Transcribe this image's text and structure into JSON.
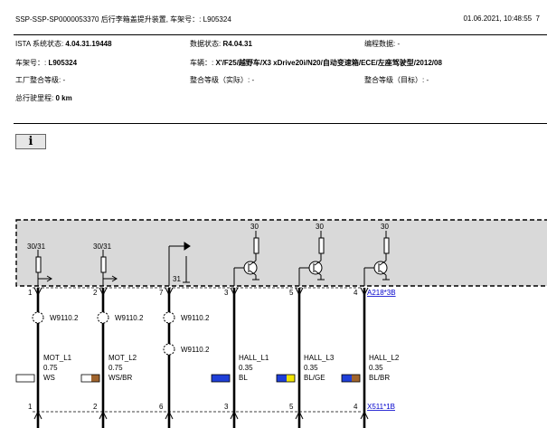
{
  "header": {
    "title": "SSP-SSP-SP0000053370 后行李箱盖提升装置, 车架号：: L905324",
    "datetime": "01.06.2021, 10:48:55",
    "page": "7"
  },
  "info": {
    "ista_label": "ISTA 系统状态: ",
    "ista_value": "4.04.31.19448",
    "data_label": "数据状态: ",
    "data_value": "R4.04.31",
    "coding_label": "编程数据: -",
    "vin_label": "车架号：: ",
    "vin_value": "L905324",
    "vehicle_label": "车辆：: ",
    "vehicle_value": "X'/F25/越野车/X3 xDrive20i/N20/自动变速箱/ECE/左座驾驶型/2012/08",
    "factory_level": "工厂整合等级: -",
    "actual_level": "整合等级（实际）: -",
    "target_level": "整合等级（目标）: -",
    "mileage_label": "总行驶里程: ",
    "mileage_value": "0 km"
  },
  "info_button": "i",
  "diagram": {
    "top_component": "A218*3B",
    "bottom_component": "X511*1B",
    "supply_labels": [
      "30/31",
      "30/31",
      "30",
      "30",
      "30"
    ],
    "ground_label": "31",
    "pins_top": [
      "1",
      "2",
      "7",
      "3",
      "5",
      "4"
    ],
    "pins_bottom": [
      "1",
      "2",
      "6",
      "3",
      "5",
      "4"
    ],
    "splices": [
      "W9110.2",
      "W9110.2",
      "W9110.2",
      "W9110.2"
    ],
    "wires": [
      {
        "name": "MOT_L1",
        "size": "0.75",
        "color": "WS",
        "swatch": [
          "#ffffff",
          "#ffffff"
        ]
      },
      {
        "name": "MOT_L2",
        "size": "0.75",
        "color": "WS/BR",
        "swatch": [
          "#ffffff",
          "#a0642d"
        ]
      },
      {
        "name": "HALL_L1",
        "size": "0.35",
        "color": "BL",
        "swatch": [
          "#1f3fd8",
          "#1f3fd8"
        ]
      },
      {
        "name": "HALL_L3",
        "size": "0.35",
        "color": "BL/GE",
        "swatch": [
          "#1f3fd8",
          "#f2e600"
        ]
      },
      {
        "name": "HALL_L2",
        "size": "0.35",
        "color": "BL/BR",
        "swatch": [
          "#1f3fd8",
          "#a0642d"
        ]
      }
    ]
  }
}
